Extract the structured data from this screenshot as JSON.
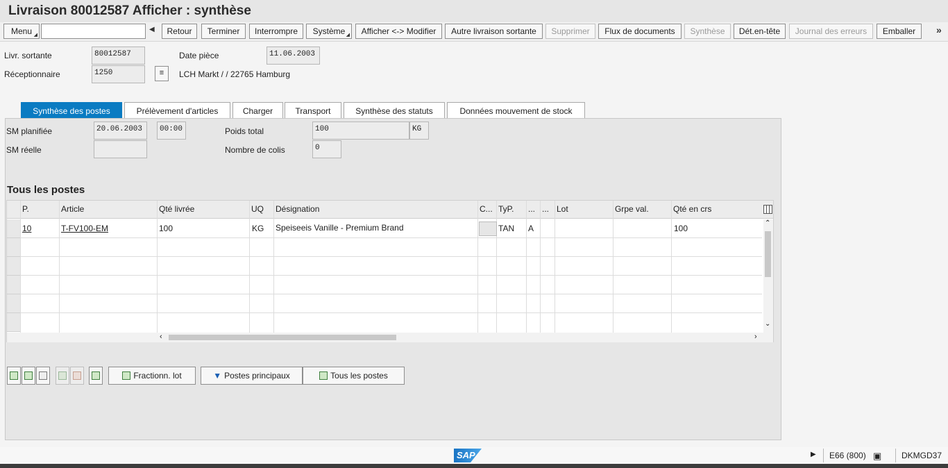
{
  "window": {
    "title": "Livraison 80012587 Afficher : synthèse"
  },
  "toolbar": {
    "menu": "Menu",
    "command_value": "",
    "retour": "Retour",
    "terminer": "Terminer",
    "interrompre": "Interrompre",
    "systeme": "Système",
    "afficher_modifier": "Afficher <-> Modifier",
    "autre_livraison": "Autre livraison sortante",
    "supprimer": "Supprimer",
    "flux": "Flux de documents",
    "synthese": "Synthèse",
    "det_entete": "Dét.en-tête",
    "journal": "Journal des erreurs",
    "emballer": "Emballer",
    "more": "»"
  },
  "header": {
    "livr_label": "Livr. sortante",
    "livr_value": "80012587",
    "date_label": "Date pièce",
    "date_value": "11.06.2003",
    "recep_label": "Réceptionnaire",
    "recep_value": "1250",
    "recep_text": "LCH Markt / / 22765 Hamburg"
  },
  "tabs": [
    {
      "label": "Synthèse des postes",
      "active": true
    },
    {
      "label": "Prélèvement d'articles"
    },
    {
      "label": "Charger"
    },
    {
      "label": "Transport"
    },
    {
      "label": "Synthèse des statuts"
    },
    {
      "label": "Données mouvement de stock"
    }
  ],
  "overview": {
    "sm_planifiee_label": "SM planifiée",
    "sm_planifiee_date": "20.06.2003",
    "sm_planifiee_time": "00:00",
    "sm_reelle_label": "SM réelle",
    "sm_reelle_value": "",
    "poids_label": "Poids total",
    "poids_value": "100",
    "poids_unit": "KG",
    "colis_label": "Nombre de colis",
    "colis_value": "0"
  },
  "items_section": {
    "title": "Tous les postes"
  },
  "table": {
    "columns": [
      "P.",
      "Article",
      "Qté livrée",
      "UQ",
      "Désignation",
      "C...",
      "TyP.",
      "...",
      "...",
      "Lot",
      "Grpe val.",
      "Qté en crs"
    ],
    "rows": [
      {
        "pos": "10",
        "article": "T-FV100-EM",
        "qty": "100",
        "uq": "KG",
        "designation": "Speiseeis  Vanille - Premium Brand",
        "c": "",
        "typ": "TAN",
        "col8": "A",
        "col9": "",
        "lot": "",
        "grpe": "",
        "qty_crs": "100"
      }
    ]
  },
  "bottom_buttons": {
    "fractionn": "Fractionn. lot",
    "principaux": "Postes principaux",
    "tous": "Tous les postes"
  },
  "status": {
    "system": "E66 (800)",
    "server": "DKMGD37",
    "logo": "SAP"
  }
}
